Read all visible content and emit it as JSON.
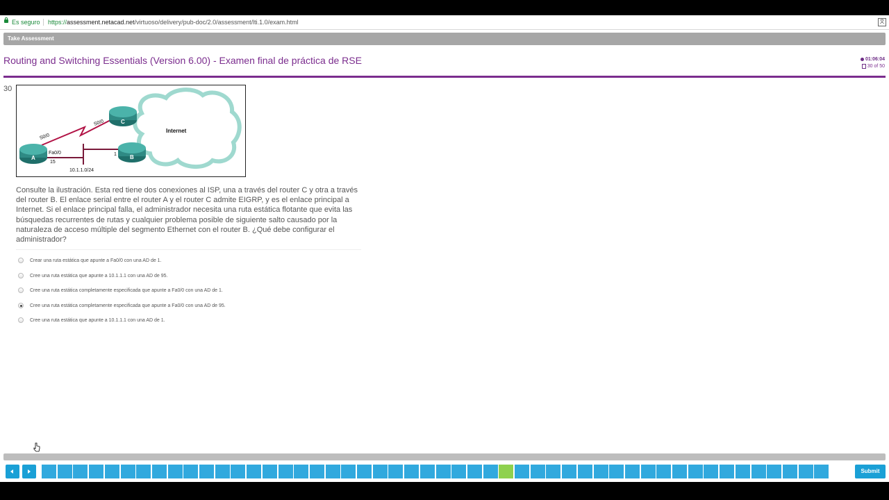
{
  "browser": {
    "secure_label": "Es seguro",
    "url_scheme": "https://",
    "url_host": "assessment.netacad.net",
    "url_path": "/virtuoso/delivery/pub-doc/2.0/assessment/lti.1.0/exam.html"
  },
  "header": {
    "take_assessment": "Take Assessment",
    "title": "Routing and Switching Essentials (Version 6.00) - Examen final de práctica de RSE",
    "timer": "01:06:04",
    "progress": "30 of 50"
  },
  "question": {
    "number": "30",
    "text": "Consulte la ilustración. Esta red tiene dos conexiones al ISP, una a través del router C y otra a través del router B. El enlace serial entre el router A y el router C admite EIGRP, y es el enlace principal a Internet. Si el enlace principal falla, el administrador necesita una ruta estática flotante que evita las búsquedas recurrentes de rutas y cualquier problema posible de siguiente salto causado por la naturaleza de acceso múltiple del segmento Ethernet con el router B. ¿Qué debe configurar el administrador?",
    "options": [
      {
        "label": "Crear una ruta estática que apunte a Fa0/0 con una AD de 1.",
        "selected": false
      },
      {
        "label": "Cree una ruta estática que apunte a 10.1.1.1 con una AD de 95.",
        "selected": false
      },
      {
        "label": "Cree una ruta estática completamente especificada que apunte a Fa0/0 con una AD de 1.",
        "selected": false
      },
      {
        "label": "Cree una ruta estática completamente especificada que apunte a Fa0/0 con una AD de 95.",
        "selected": true
      },
      {
        "label": "Cree una ruta estática que apunte a 10.1.1.1 con una AD de 1.",
        "selected": false
      }
    ]
  },
  "diagram": {
    "internet": "Internet",
    "router_a": "A",
    "router_b": "B",
    "router_c": "C",
    "s00_a": "S0/0",
    "s00_c": "S0/0",
    "fa00": "Fa0/0",
    "port_15": "15",
    "port_1": "1",
    "network": "10.1.1.0/24"
  },
  "footer": {
    "submit": "Submit",
    "question_count": 50,
    "current_question": 30
  },
  "colors": {
    "accent_purple": "#7b2d8e",
    "nav_blue": "#31a9de",
    "current_green": "#8fd14f"
  }
}
